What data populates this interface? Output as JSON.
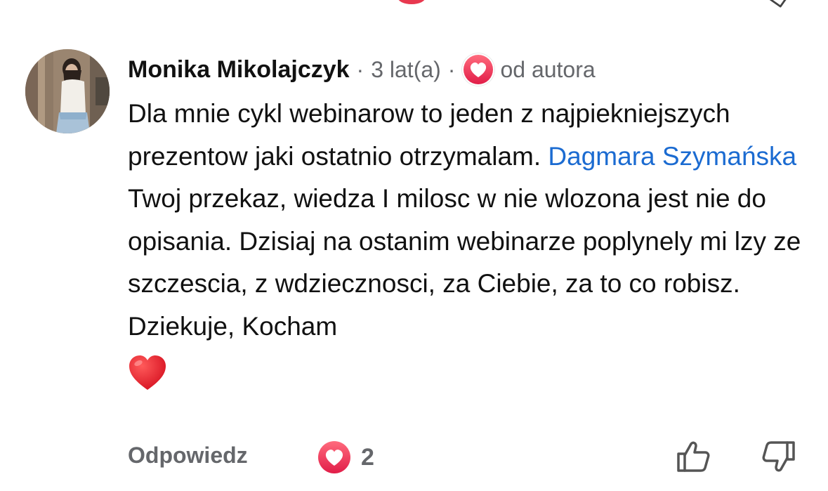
{
  "comment": {
    "author": "Monika Mikolajczyk",
    "time": "3 lat(a)",
    "separator": "·",
    "author_badge": "od autora",
    "text_part1": "Dla mnie cykl webinarow to jeden z najpiekniejszych prezentow jaki ostatnio otrzymalam.",
    "mention": "Dagmara Szymańska",
    "text_part2": "Twoj przekaz, wiedza I milosc w nie wlozona jest nie do opisania. Dzisiaj na ostanim webinarze poplynely mi lzy ze szczescia, z wdziecznosci, za Ciebie, za to co robisz. Dziekuje, Kocham"
  },
  "actions": {
    "reply_label": "Odpowiedz",
    "heart_count": "2"
  },
  "icons": {
    "author_heart": "heart-icon",
    "emoji": "red-heart-emoji",
    "reaction": "heart-reaction-icon",
    "like": "thumbs-up-icon",
    "dislike": "thumbs-down-icon"
  },
  "colors": {
    "mention": "#1b6bd1",
    "muted": "#65676b",
    "heart": "#e8384f"
  }
}
